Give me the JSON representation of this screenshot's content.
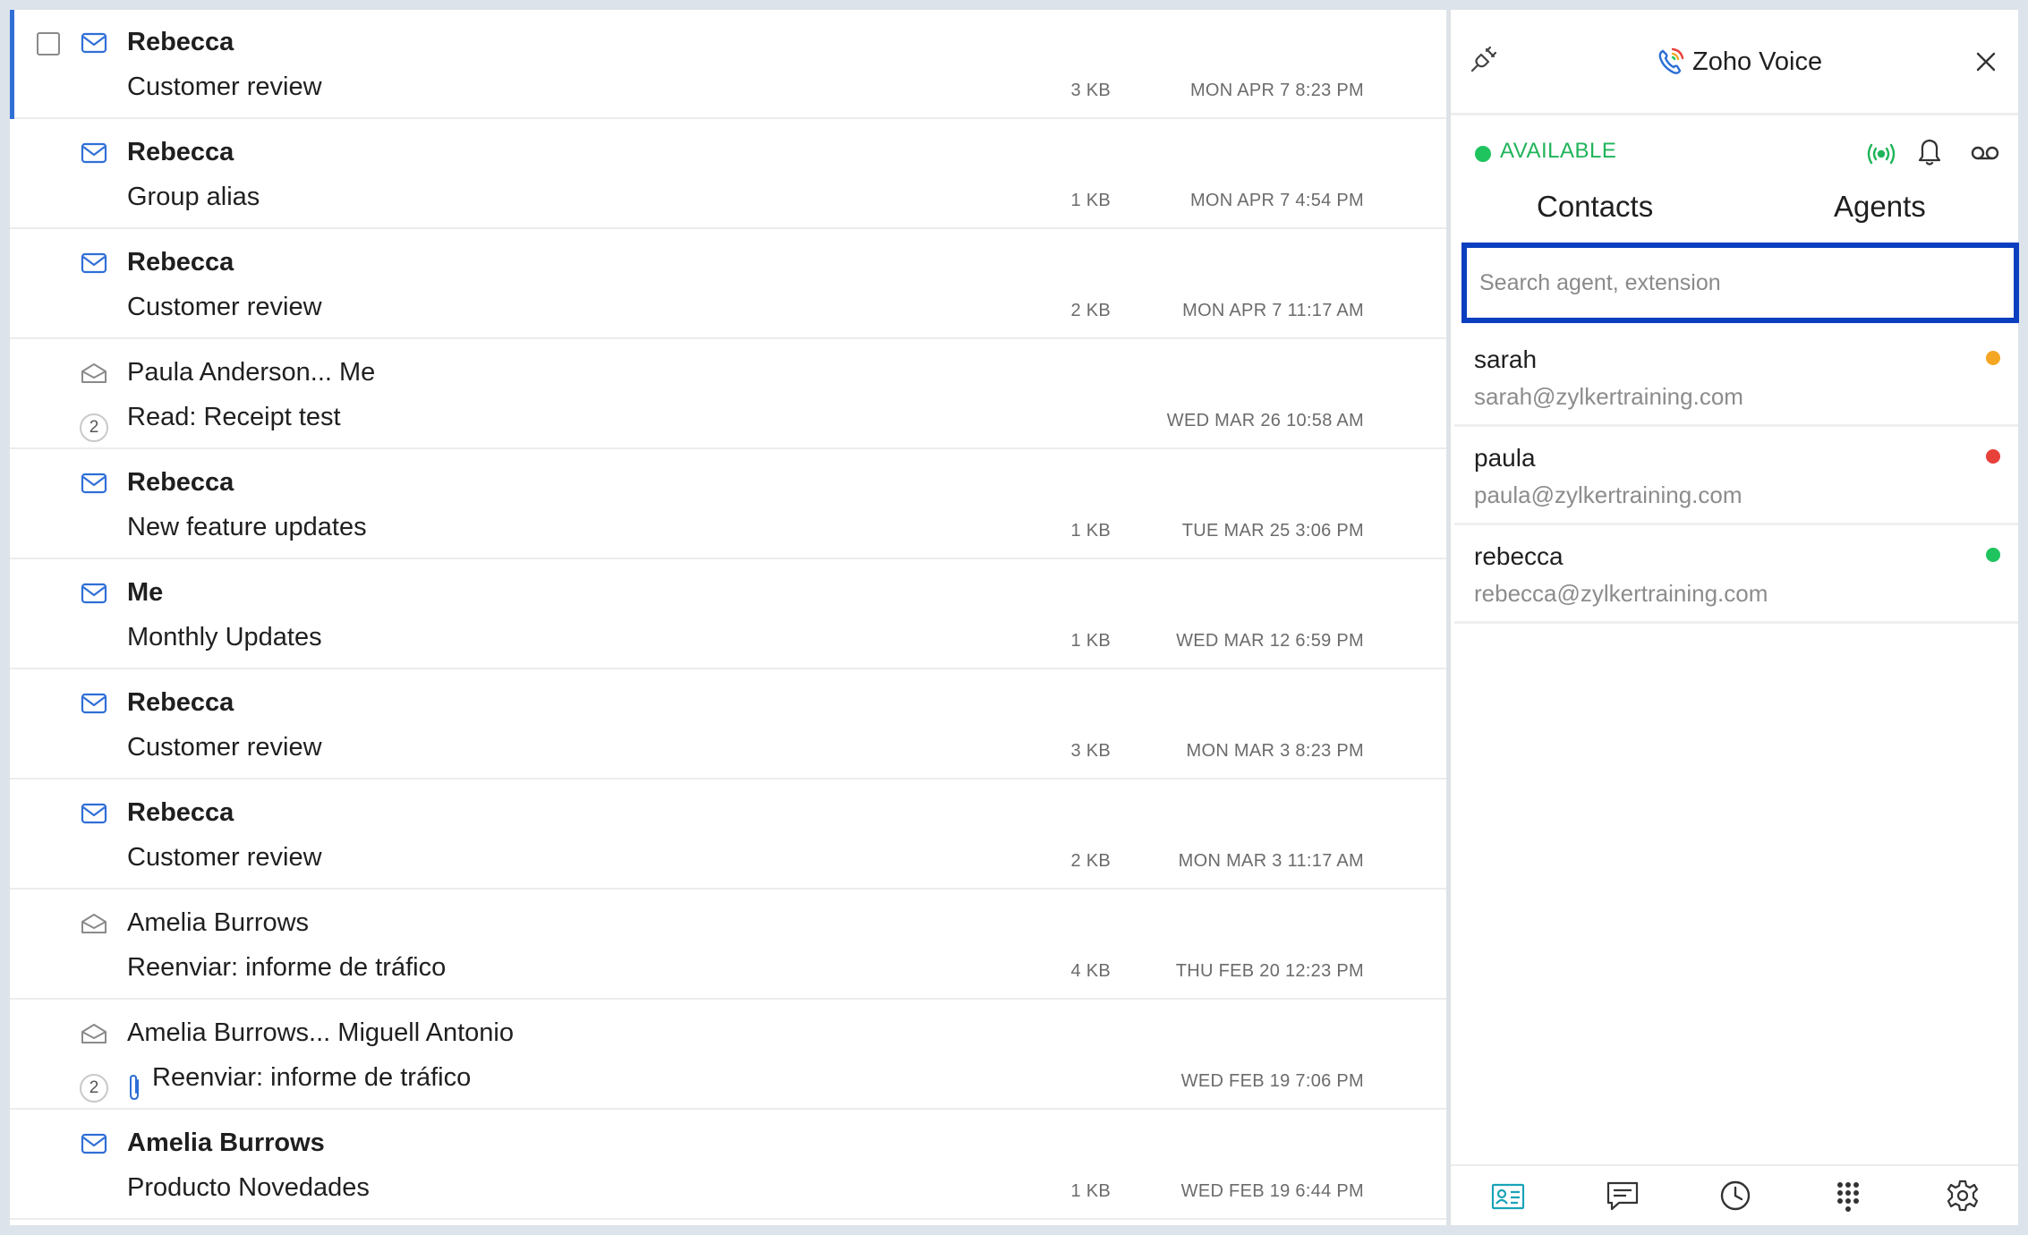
{
  "mail_list": [
    {
      "sender": "Rebecca",
      "subject": "Customer review",
      "size": "3 KB",
      "date": "MON APR 7 8:23 PM",
      "unread": true,
      "selected": true,
      "icon": "envelope-closed-icon"
    },
    {
      "sender": "Rebecca",
      "subject": "Group alias",
      "size": "1 KB",
      "date": "MON APR 7 4:54 PM",
      "unread": true,
      "icon": "envelope-closed-icon"
    },
    {
      "sender": "Rebecca",
      "subject": "Customer review",
      "size": "2 KB",
      "date": "MON APR 7 11:17 AM",
      "unread": true,
      "icon": "envelope-closed-icon"
    },
    {
      "sender": "Paula Anderson... Me",
      "subject": "Read: Receipt test",
      "size": "",
      "date": "WED MAR 26 10:58 AM",
      "unread": false,
      "thread_count": "2",
      "icon": "envelope-open-icon"
    },
    {
      "sender": "Rebecca",
      "subject": "New feature updates",
      "size": "1 KB",
      "date": "TUE MAR 25 3:06 PM",
      "unread": true,
      "icon": "envelope-closed-icon"
    },
    {
      "sender": "Me",
      "subject": "Monthly Updates",
      "size": "1 KB",
      "date": "WED MAR 12 6:59 PM",
      "unread": true,
      "icon": "envelope-closed-icon"
    },
    {
      "sender": "Rebecca",
      "subject": "Customer review",
      "size": "3 KB",
      "date": "MON MAR 3 8:23 PM",
      "unread": true,
      "icon": "envelope-closed-icon"
    },
    {
      "sender": "Rebecca",
      "subject": "Customer review",
      "size": "2 KB",
      "date": "MON MAR 3 11:17 AM",
      "unread": true,
      "icon": "envelope-closed-icon"
    },
    {
      "sender": "Amelia Burrows",
      "subject": "Reenviar: informe de tráfico",
      "size": "4 KB",
      "date": "THU FEB 20 12:23 PM",
      "unread": false,
      "icon": "envelope-open-icon"
    },
    {
      "sender": "Amelia Burrows... Miguell Antonio",
      "subject": "Reenviar: informe de tráfico",
      "size": "",
      "date": "WED FEB 19 7:06 PM",
      "unread": false,
      "thread_count": "2",
      "attachment": true,
      "icon": "envelope-open-icon"
    },
    {
      "sender": "Amelia Burrows",
      "subject": "Producto Novedades",
      "size": "1 KB",
      "date": "WED FEB 19 6:44 PM",
      "unread": true,
      "icon": "envelope-closed-icon"
    }
  ],
  "voice_panel": {
    "title": "Zoho Voice",
    "status": "AVAILABLE",
    "status_color": "#1fc45e",
    "tabs": [
      "Contacts",
      "Agents"
    ],
    "search": {
      "placeholder": "Search agent, extension",
      "value": ""
    },
    "agents": [
      {
        "name": "sarah",
        "email": "sarah@zylkertraining.com",
        "status_color": "#f5a623"
      },
      {
        "name": "paula",
        "email": "paula@zylkertraining.com",
        "status_color": "#e8413a"
      },
      {
        "name": "rebecca",
        "email": "rebecca@zylkertraining.com",
        "status_color": "#1fc45e"
      }
    ],
    "bottom_nav": [
      "contacts-card-icon",
      "chat-icon",
      "clock-icon",
      "dialpad-icon",
      "gear-icon"
    ],
    "colors": {
      "accent": "#0b3fbf",
      "teal": "#1aa3b8",
      "selected_bar": "#2f6fd6"
    }
  }
}
